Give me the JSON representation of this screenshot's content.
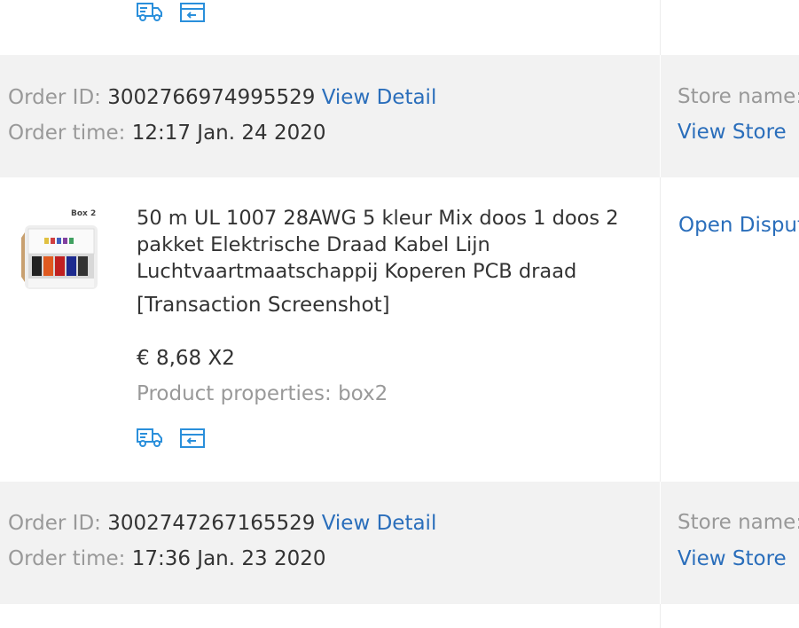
{
  "orders": [
    {
      "order_id_label": "Order ID:",
      "order_id": "3002766974995529",
      "view_detail": "View Detail",
      "order_time_label": "Order time:",
      "order_time": "12:17 Jan. 24 2020",
      "store_name_label": "Store name:",
      "view_store": "View Store",
      "separator": "|",
      "item": {
        "image_text": "Box 2",
        "title": "50 m UL 1007 28AWG 5 kleur Mix doos 1 doos 2 pakket Elektrische Draad Kabel Lijn Luchtvaartmaatschappij Koperen PCB draad",
        "screenshot_link": "[Transaction Screenshot]",
        "price": "€ 8,68 X2",
        "properties": "Product properties: box2",
        "open_dispute": "Open Disput"
      }
    },
    {
      "order_id_label": "Order ID:",
      "order_id": "3002747267165529",
      "view_detail": "View Detail",
      "order_time_label": "Order time:",
      "order_time": "17:36 Jan. 23 2020",
      "store_name_label": "Store name:",
      "view_store": "View Store",
      "separator": "|"
    }
  ],
  "icons": [
    "shipping-truck-icon",
    "return-box-icon"
  ],
  "colors": {
    "link": "#2a6ebb",
    "header_bg": "#f2f2f2",
    "label": "#999999",
    "icon": "#2a8fdb"
  }
}
